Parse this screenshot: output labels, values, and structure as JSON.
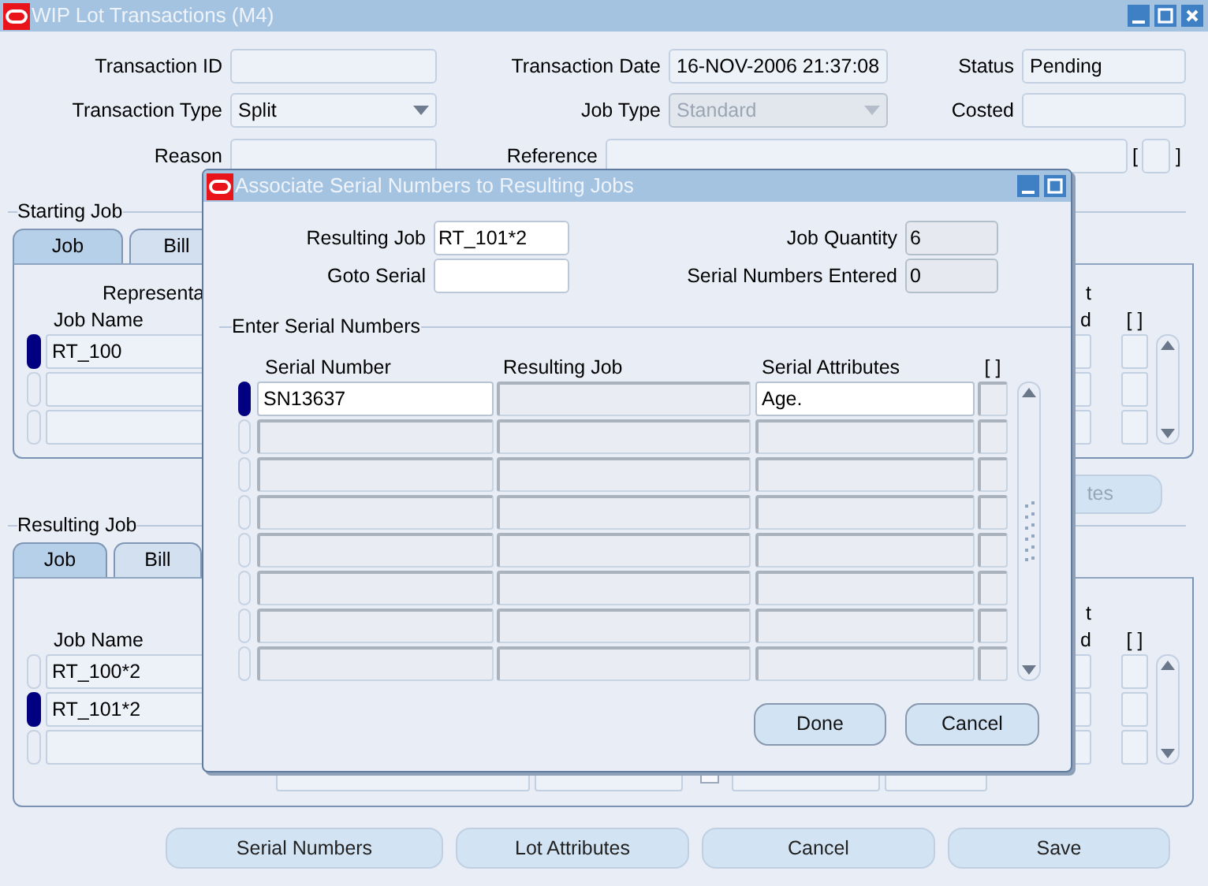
{
  "window": {
    "title": "WIP Lot Transactions (M4)"
  },
  "header_rows": [
    [
      {
        "label": "Transaction ID",
        "kind": "text",
        "disabled": false
      },
      {
        "label": "Transaction Date",
        "value": "16-NOV-2006 21:37:08",
        "kind": "text",
        "disabled": false
      },
      {
        "label": "Status",
        "value": "Pending",
        "kind": "text",
        "disabled": false
      }
    ],
    [
      {
        "label": "Transaction Type",
        "value": "Split",
        "kind": "dropdown",
        "disabled": false
      },
      {
        "label": "Job Type",
        "value": "Standard",
        "kind": "dropdown",
        "disabled": true
      },
      {
        "label": "Costed",
        "kind": "text",
        "disabled": false
      }
    ],
    [
      {
        "label": "Reason",
        "kind": "text",
        "disabled": false
      },
      {
        "label": "Reference",
        "kind": "text",
        "disabled": false
      },
      {
        "kind": "flex",
        "open": "[",
        "close": "]"
      }
    ]
  ],
  "starting_job": {
    "title": "Starting Job",
    "tabs": [
      {
        "label": "Job",
        "selected": true
      },
      {
        "label": "Bill",
        "selected": false
      }
    ],
    "group_heading": "Representa",
    "job_name_heading": "Job Name",
    "right_heading": [
      "t",
      "d"
    ],
    "flex_heading": "[ ]",
    "rows": [
      {
        "job_name": "RT_100",
        "current": true
      },
      {
        "current": false
      },
      {
        "current": false
      }
    ]
  },
  "side_button": {
    "label": "tes",
    "disabled": true
  },
  "resulting_job": {
    "title": "Resulting Job",
    "tabs": [
      {
        "label": "Job",
        "selected": true
      },
      {
        "label": "Bill",
        "selected": false
      }
    ],
    "job_name_heading": "Job Name",
    "right_heading": [
      "t",
      "d"
    ],
    "flex_heading": "[ ]",
    "rows": [
      {
        "job_name": "RT_100*2",
        "current": false
      },
      {
        "job_name": "RT_101*2",
        "current": true
      },
      {
        "current": false
      }
    ]
  },
  "buttons": [
    {
      "label": "Serial Numbers"
    },
    {
      "label": "Lot Attributes"
    },
    {
      "label": "Cancel"
    },
    {
      "label": "Save"
    }
  ],
  "dialog": {
    "title": "Associate Serial Numbers to Resulting Jobs",
    "field_rows": [
      [
        {
          "label": "Resulting Job",
          "value": "RT_101*2",
          "disabled": false
        },
        {
          "label": "Job Quantity",
          "value": "6",
          "disabled": true
        }
      ],
      [
        {
          "label": "Goto Serial",
          "disabled": false
        },
        {
          "label": "Serial Numbers Entered",
          "value": "0",
          "disabled": true
        }
      ]
    ],
    "section": "Enter Serial Numbers",
    "columns": [
      "Serial Number",
      "Resulting Job",
      "Serial Attributes",
      "[ ]"
    ],
    "rows": [
      {
        "serial_number": "SN13637",
        "serial_attributes": "Age.",
        "current": true
      },
      {
        "current": false
      },
      {
        "current": false
      },
      {
        "current": false
      },
      {
        "current": false
      },
      {
        "current": false
      },
      {
        "current": false
      },
      {
        "current": false
      }
    ],
    "buttons": [
      {
        "label": "Done"
      },
      {
        "label": "Cancel"
      }
    ]
  }
}
